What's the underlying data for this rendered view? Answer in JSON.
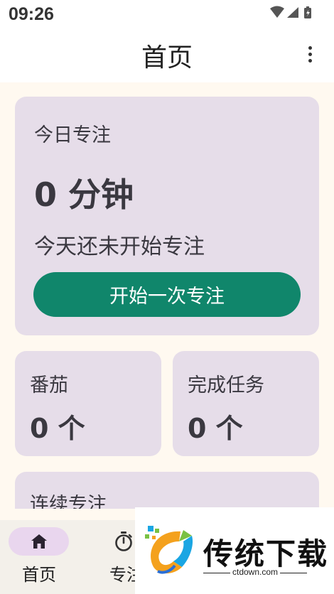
{
  "status_bar": {
    "time": "09:26",
    "icons": [
      "wifi-icon",
      "signal-icon",
      "battery-icon"
    ]
  },
  "app_bar": {
    "title": "首页",
    "menu_icon": "more-vert-icon"
  },
  "today": {
    "label": "今日专注",
    "value": "0 分钟",
    "status": "今天还未开始专注",
    "start_button": "开始一次专注"
  },
  "stats": {
    "tomato": {
      "label": "番茄",
      "value": "0 个"
    },
    "tasks": {
      "label": "完成任务",
      "value": "0 个"
    }
  },
  "streak": {
    "label": "连续专注"
  },
  "bottom_nav": {
    "items": [
      {
        "label": "首页",
        "icon": "home-icon",
        "selected": true
      },
      {
        "label": "专注",
        "icon": "stopwatch-icon",
        "selected": false
      }
    ]
  },
  "watermark": {
    "title": "传统下载",
    "subtitle": "ctdown.com"
  },
  "colors": {
    "accent": "#10866b",
    "card": "#e6dde9",
    "background": "#fff9f0",
    "nav_pill": "#e9d6ee"
  }
}
